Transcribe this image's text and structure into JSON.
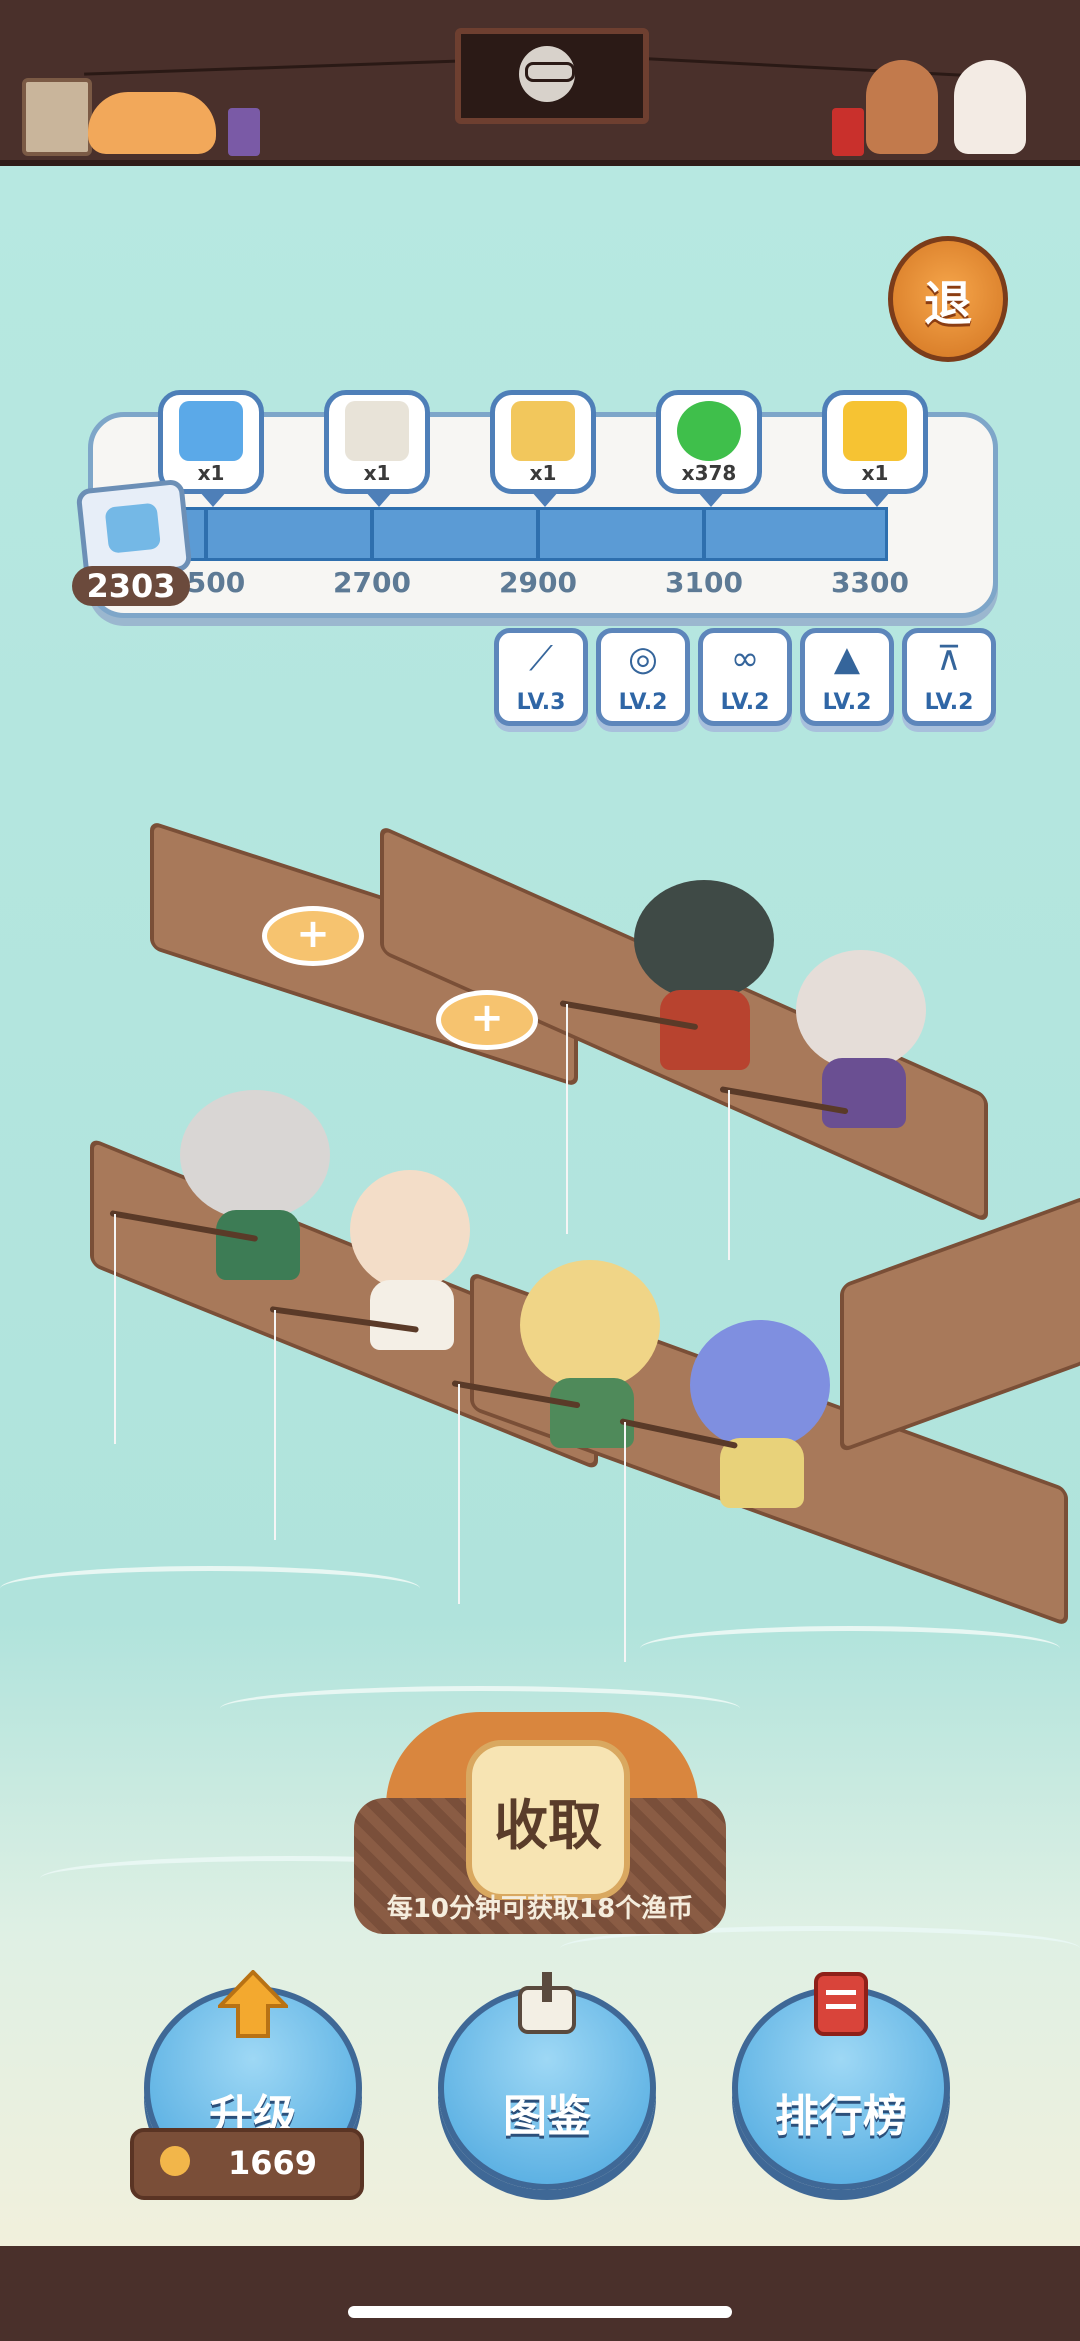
{
  "header": {
    "portrait": "raccoon-portrait"
  },
  "quit_label": "退",
  "progress": {
    "score": "2303",
    "milestones": [
      {
        "value": "2500",
        "label": "500",
        "reward_icon": "character-card-icon",
        "count": "x1",
        "color": "#5ba9e8"
      },
      {
        "value": "2700",
        "label": "2700",
        "reward_icon": "dice-ticket-icon",
        "count": "x1",
        "color": "#e8e3d8"
      },
      {
        "value": "2900",
        "label": "2900",
        "reward_icon": "llama-card-icon",
        "count": "x1",
        "color": "#f2c75c"
      },
      {
        "value": "3100",
        "label": "3100",
        "reward_icon": "green-coin-icon",
        "count": "x378",
        "color": "#3fbf4b"
      },
      {
        "value": "3300",
        "label": "3300",
        "reward_icon": "calendar-ticket-icon",
        "count": "x1",
        "color": "#f6c333"
      }
    ],
    "fill_fraction": 1.0
  },
  "upgrades": [
    {
      "name": "rod-upgrade",
      "icon": "fishing-rod-icon",
      "level": "LV.3"
    },
    {
      "name": "reel-upgrade",
      "icon": "reel-icon",
      "level": "LV.2"
    },
    {
      "name": "line-upgrade",
      "icon": "line-spool-icon",
      "level": "LV.2"
    },
    {
      "name": "bait-upgrade",
      "icon": "bait-icon",
      "level": "LV.2"
    },
    {
      "name": "stand-upgrade",
      "icon": "stand-icon",
      "level": "LV.2"
    }
  ],
  "collect": {
    "label": "收取",
    "note": "每10分钟可获取18个渔币"
  },
  "buttons": {
    "upgrade": "升级",
    "collection": "图鉴",
    "ranking": "排行榜"
  },
  "coins": "1669",
  "colors": {
    "topbar": "#4a302b",
    "sea": "#b7e8e1",
    "accent": "#5b9bd5",
    "button": "#4aa6de"
  }
}
